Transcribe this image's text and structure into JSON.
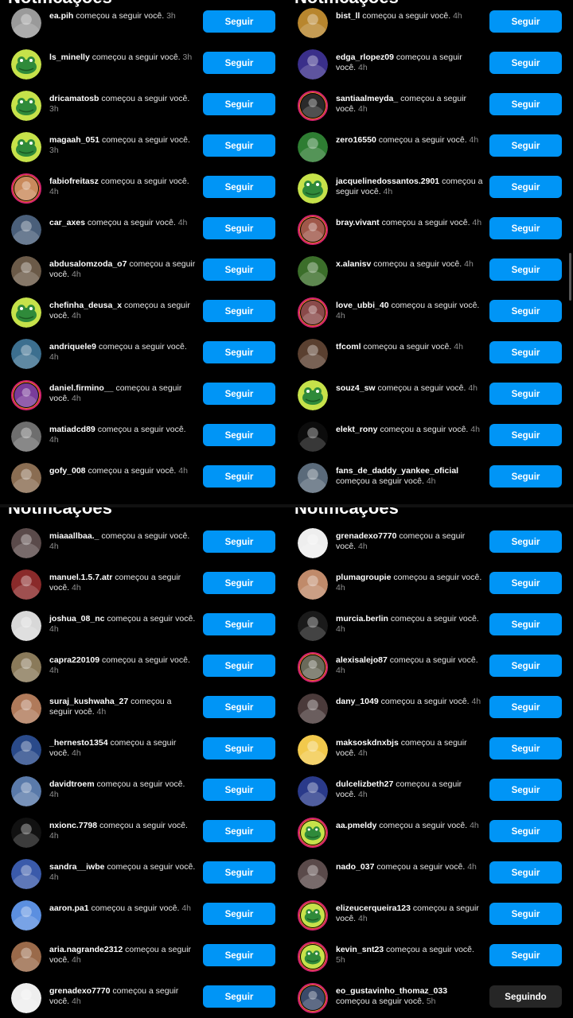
{
  "header_text": "Notificações",
  "follow_label": "Seguir",
  "following_label": "Seguindo",
  "action_text": "começou a seguir você.",
  "quadrants": [
    {
      "id": "tl",
      "rows": [
        {
          "user": "ea.pih",
          "time": "3h",
          "style": "photo",
          "color": "#9a9a9a"
        },
        {
          "user": "ls_minelly",
          "time": "3h",
          "style": "frog"
        },
        {
          "user": "dricamatosb",
          "time": "3h",
          "style": "frog"
        },
        {
          "user": "magaah_051",
          "time": "3h",
          "style": "frog"
        },
        {
          "user": "fabiofreitasz",
          "time": "4h",
          "style": "ring",
          "color": "#c98a5c"
        },
        {
          "user": "car_axes",
          "time": "4h",
          "style": "photo",
          "color": "#4a5f7a"
        },
        {
          "user": "abdusalomzoda_o7",
          "time": "4h",
          "style": "photo",
          "color": "#6b5a48"
        },
        {
          "user": "chefinha_deusa_x",
          "time": "4h",
          "style": "frog"
        },
        {
          "user": "andriquele9",
          "time": "4h",
          "style": "photo",
          "color": "#3c6f8f"
        },
        {
          "user": "daniel.firmino__",
          "time": "4h",
          "style": "ring",
          "color": "#7a3c9a"
        },
        {
          "user": "matiadcd89",
          "time": "4h",
          "style": "photo",
          "color": "#6e6e6e"
        },
        {
          "user": "gofy_008",
          "time": "4h",
          "style": "photo",
          "color": "#8a6d52"
        }
      ]
    },
    {
      "id": "tr",
      "rows": [
        {
          "user": "bist_ll",
          "time": "4h",
          "style": "photo",
          "color": "#b8862e"
        },
        {
          "user": "edga_rlopez09",
          "time": "4h",
          "style": "photo",
          "color": "#3a2f8a"
        },
        {
          "user": "santiaalmeyda_",
          "time": "4h",
          "style": "ring",
          "color": "#2a2a2a"
        },
        {
          "user": "zero16550",
          "time": "4h",
          "style": "photo",
          "color": "#2e7d32"
        },
        {
          "user": "jacquelinedossantos.2901",
          "time": "4h",
          "style": "frog"
        },
        {
          "user": "bray.vivant",
          "time": "4h",
          "style": "ring",
          "color": "#a0584a"
        },
        {
          "user": "x.alanisv",
          "time": "4h",
          "style": "photo",
          "color": "#3b6e2a"
        },
        {
          "user": "love_ubbi_40",
          "time": "4h",
          "style": "ring",
          "color": "#8a4a4a"
        },
        {
          "user": "tfcoml",
          "time": "4h",
          "style": "photo",
          "color": "#5a4030"
        },
        {
          "user": "souz4_sw",
          "time": "4h",
          "style": "frog"
        },
        {
          "user": "elekt_rony",
          "time": "4h",
          "style": "photo",
          "color": "#0c0c0c"
        },
        {
          "user": "fans_de_daddy_yankee_oficial",
          "time": "4h",
          "style": "photo",
          "color": "#5a6a7a"
        }
      ]
    },
    {
      "id": "bl",
      "rows": [
        {
          "user": "miaaallbaa._",
          "time": "4h",
          "style": "photo",
          "color": "#5a4a4a"
        },
        {
          "user": "manuel.1.5.7.atr",
          "time": "4h",
          "style": "photo",
          "color": "#8a2a2a"
        },
        {
          "user": "joshua_08_nc",
          "time": "4h",
          "style": "photo",
          "color": "#d8d8d8"
        },
        {
          "user": "capra220109",
          "time": "4h",
          "style": "photo",
          "color": "#8a7a5a"
        },
        {
          "user": "suraj_kushwaha_27",
          "time": "4h",
          "style": "photo",
          "color": "#b07a5a"
        },
        {
          "user": "_hernesto1354",
          "time": "4h",
          "style": "photo",
          "color": "#2a4a8a"
        },
        {
          "user": "davidtroem",
          "time": "4h",
          "style": "photo",
          "color": "#5a7aaa"
        },
        {
          "user": "nxionc.7798",
          "time": "4h",
          "style": "photo",
          "color": "#111111"
        },
        {
          "user": "sandra__iwbe",
          "time": "4h",
          "style": "photo",
          "color": "#3a5aaa"
        },
        {
          "user": "aaron.pa1",
          "time": "4h",
          "style": "photo",
          "color": "#5b8fe0"
        },
        {
          "user": "aria.nagrande2312",
          "time": "4h",
          "style": "photo",
          "color": "#9a6a4a"
        },
        {
          "user": "grenadexo7770",
          "time": "4h",
          "style": "photo",
          "color": "#eeeeee"
        }
      ]
    },
    {
      "id": "br",
      "rows": [
        {
          "user": "grenadexo7770",
          "time": "4h",
          "style": "photo",
          "color": "#eeeeee"
        },
        {
          "user": "plumagroupie",
          "time": "4h",
          "style": "photo",
          "color": "#c08a6a"
        },
        {
          "user": "murcia.berlin",
          "time": "4h",
          "style": "photo",
          "color": "#1a1a1a"
        },
        {
          "user": "alexisalejo87",
          "time": "4h",
          "style": "ring",
          "color": "#6a6a5a"
        },
        {
          "user": "dany_1049",
          "time": "4h",
          "style": "photo",
          "color": "#4a3a3a"
        },
        {
          "user": "maksoskdnxbjs",
          "time": "4h",
          "style": "photo",
          "color": "#f2c94c"
        },
        {
          "user": "dulcelizbeth27",
          "time": "4h",
          "style": "photo",
          "color": "#2a3a8a"
        },
        {
          "user": "aa.pmeldy",
          "time": "4h",
          "style": "frogring"
        },
        {
          "user": "nado_037",
          "time": "4h",
          "style": "photo",
          "color": "#5a4a4a"
        },
        {
          "user": "elizeucerqueira123",
          "time": "4h",
          "style": "frogring"
        },
        {
          "user": "kevin_snt23",
          "time": "5h",
          "style": "frogring"
        },
        {
          "user": "eo_gustavinho_thomaz_033",
          "time": "5h",
          "style": "ring",
          "color": "#3a4a6a",
          "following": true
        }
      ]
    }
  ]
}
